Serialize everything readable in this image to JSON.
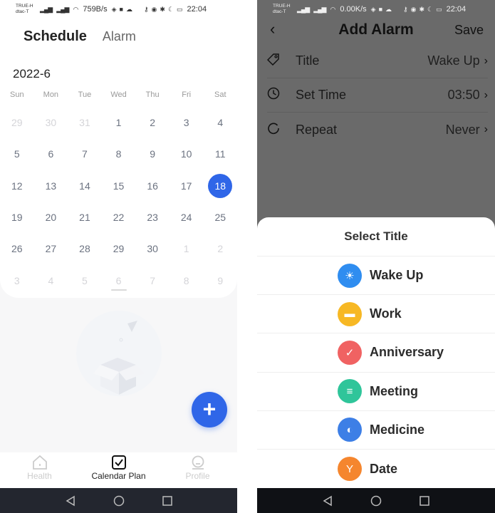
{
  "left": {
    "status": {
      "carrier1": "TRUE-H",
      "carrier2": "dtac-T",
      "net_speed": "759B/s",
      "time": "22:04"
    },
    "tabs": [
      {
        "label": "Schedule",
        "active": true
      },
      {
        "label": "Alarm",
        "active": false
      }
    ],
    "month": "2022-6",
    "weekdays": [
      "Sun",
      "Mon",
      "Tue",
      "Wed",
      "Thu",
      "Fri",
      "Sat"
    ],
    "weeks": [
      [
        {
          "d": "29",
          "dim": true
        },
        {
          "d": "30",
          "dim": true
        },
        {
          "d": "31",
          "dim": true
        },
        {
          "d": "1"
        },
        {
          "d": "2"
        },
        {
          "d": "3"
        },
        {
          "d": "4"
        }
      ],
      [
        {
          "d": "5"
        },
        {
          "d": "6"
        },
        {
          "d": "7"
        },
        {
          "d": "8"
        },
        {
          "d": "9"
        },
        {
          "d": "10"
        },
        {
          "d": "11"
        }
      ],
      [
        {
          "d": "12"
        },
        {
          "d": "13"
        },
        {
          "d": "14"
        },
        {
          "d": "15"
        },
        {
          "d": "16"
        },
        {
          "d": "17"
        },
        {
          "d": "18",
          "selected": true
        }
      ],
      [
        {
          "d": "19"
        },
        {
          "d": "20"
        },
        {
          "d": "21"
        },
        {
          "d": "22"
        },
        {
          "d": "23"
        },
        {
          "d": "24"
        },
        {
          "d": "25"
        }
      ],
      [
        {
          "d": "26"
        },
        {
          "d": "27"
        },
        {
          "d": "28"
        },
        {
          "d": "29"
        },
        {
          "d": "30"
        },
        {
          "d": "1",
          "dim": true
        },
        {
          "d": "2",
          "dim": true
        }
      ],
      [
        {
          "d": "3",
          "dim": true
        },
        {
          "d": "4",
          "dim": true
        },
        {
          "d": "5",
          "dim": true
        },
        {
          "d": "6",
          "dim": true
        },
        {
          "d": "7",
          "dim": true
        },
        {
          "d": "8",
          "dim": true
        },
        {
          "d": "9",
          "dim": true
        }
      ]
    ],
    "fab_label": "+",
    "nav": [
      {
        "label": "Health",
        "active": false
      },
      {
        "label": "Calendar Plan",
        "active": true
      },
      {
        "label": "Profile",
        "active": false
      }
    ],
    "accent": "#2f66e8"
  },
  "right": {
    "status": {
      "carrier1": "TRUE-H",
      "carrier2": "dtac-T",
      "net_speed": "0.00K/s",
      "time": "22:04"
    },
    "header": {
      "title": "Add Alarm",
      "save": "Save"
    },
    "rows": [
      {
        "label": "Title",
        "value": "Wake Up",
        "icon": "tag-icon"
      },
      {
        "label": "Set Time",
        "value": "03:50",
        "icon": "clock-icon"
      },
      {
        "label": "Repeat",
        "value": "Never",
        "icon": "repeat-icon"
      }
    ],
    "sheet": {
      "title": "Select Title",
      "options": [
        {
          "label": "Wake Up",
          "icon": "sunrise-icon",
          "color": "#2f8df0"
        },
        {
          "label": "Work",
          "icon": "briefcase-icon",
          "color": "#f7b824"
        },
        {
          "label": "Anniversary",
          "icon": "calendar-check-icon",
          "color": "#f06262"
        },
        {
          "label": "Meeting",
          "icon": "chat-board-icon",
          "color": "#2fc59a"
        },
        {
          "label": "Medicine",
          "icon": "pill-icon",
          "color": "#3d7fe6"
        },
        {
          "label": "Date",
          "icon": "cocktail-icon",
          "color": "#f5862e"
        }
      ]
    }
  }
}
